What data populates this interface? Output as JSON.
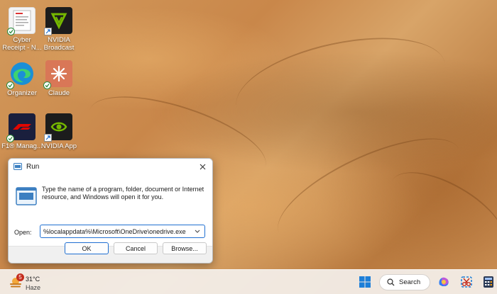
{
  "desktop": {
    "icons": [
      {
        "label": "Cyber Receipt - N..."
      },
      {
        "label": "NVIDIA Broadcast"
      },
      {
        "label": "Organizer"
      },
      {
        "label": "Claude"
      },
      {
        "label": "F1® Manag..."
      },
      {
        "label": "NVIDIA App"
      }
    ]
  },
  "run_dialog": {
    "title": "Run",
    "description": "Type the name of a program, folder, document or Internet resource, and Windows will open it for you.",
    "open_label": "Open:",
    "open_value": "%localappdata%\\Microsoft\\OneDrive\\onedrive.exe",
    "ok_label": "OK",
    "cancel_label": "Cancel",
    "browse_label": "Browse..."
  },
  "taskbar": {
    "weather": {
      "badge": "5",
      "temperature": "31°C",
      "condition": "Haze"
    },
    "search_label": "Search",
    "icons": [
      "start-icon",
      "search-icon",
      "copilot-icon",
      "snipping-tool-icon",
      "calculator-icon"
    ]
  }
}
